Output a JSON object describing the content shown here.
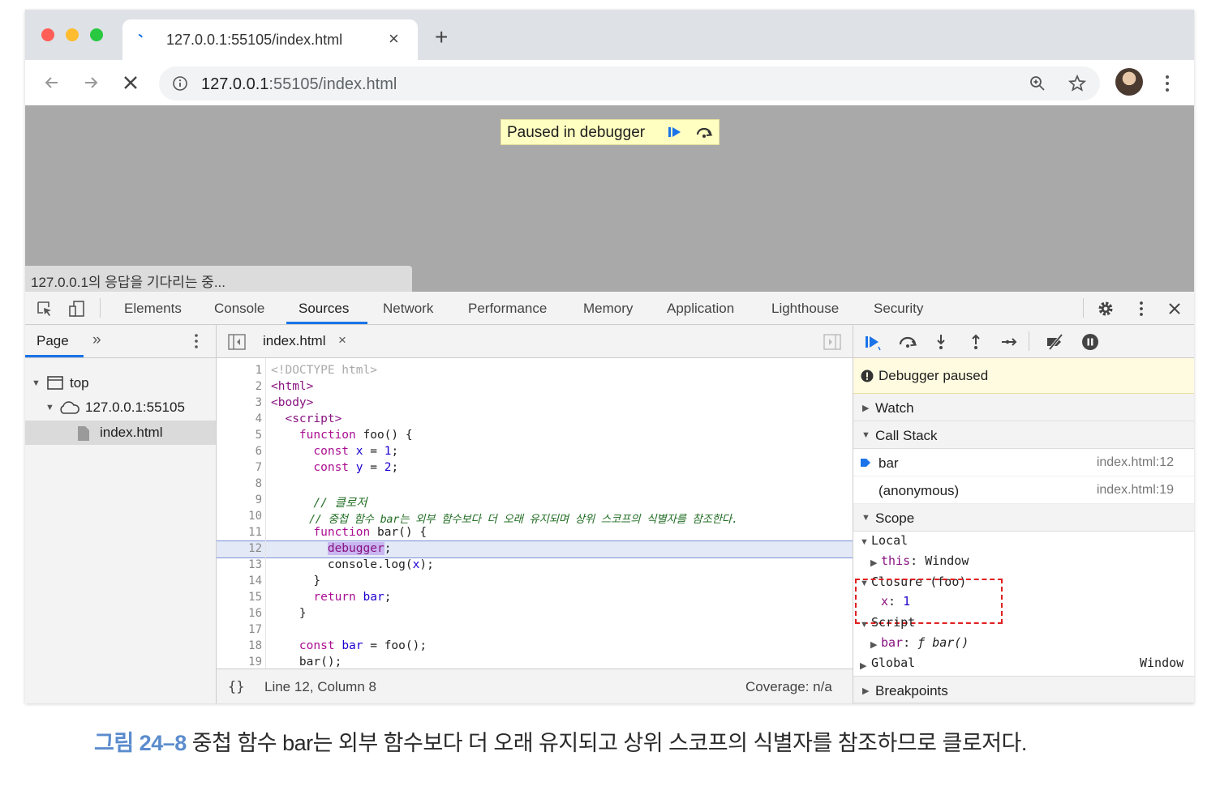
{
  "browser": {
    "tab_title": "127.0.0.1:55105/index.html",
    "url_host": "127.0.0.1",
    "url_rest": ":55105/index.html"
  },
  "page": {
    "paused_banner": "Paused in debugger",
    "status_bubble": "127.0.0.1의 응답을 기다리는 중..."
  },
  "devtools": {
    "tabs": [
      "Elements",
      "Console",
      "Sources",
      "Network",
      "Performance",
      "Memory",
      "Application",
      "Lighthouse",
      "Security"
    ],
    "active_tab": "Sources",
    "navigator": {
      "tab": "Page",
      "more": "»",
      "tree": [
        "top",
        "127.0.0.1:55105",
        "index.html"
      ]
    },
    "editor": {
      "file_tab": "index.html",
      "close": "×",
      "line_numbers": [
        "1",
        "2",
        "3",
        "4",
        "5",
        "6",
        "7",
        "8",
        "9",
        "10",
        "11",
        "12",
        "13",
        "14",
        "15",
        "16",
        "17",
        "18",
        "19"
      ],
      "status_braces": "{}",
      "status_position": "Line 12, Column 8",
      "status_coverage": "Coverage: n/a"
    },
    "sidebar": {
      "paused": "Debugger paused",
      "watch": "Watch",
      "call_stack": "Call Stack",
      "frames": [
        {
          "name": "bar",
          "location": "index.html:12"
        },
        {
          "name": "(anonymous)",
          "location": "index.html:19"
        }
      ],
      "scope": "Scope",
      "local": "Local",
      "local_this_key": "this",
      "local_this_val": "Window",
      "closure": "Closure (foo)",
      "closure_key": "x",
      "closure_val": "1",
      "script": "Script",
      "script_key": "bar",
      "script_val": "ƒ bar()",
      "global": "Global",
      "global_val": "Window",
      "breakpoints": "Breakpoints"
    }
  },
  "caption": {
    "label": "그림 24–8",
    "text": "중첩 함수 bar는 외부 함수보다 더 오래 유지되고 상위 스코프의 식별자를 참조하므로 클로저다."
  },
  "colors": {
    "accent": "#1a73e8",
    "paused_bg": "#ffffc2",
    "highlight_line": "#e4e9f7",
    "closure_outline": "#e02020",
    "caption_label": "#5b8ccd"
  }
}
